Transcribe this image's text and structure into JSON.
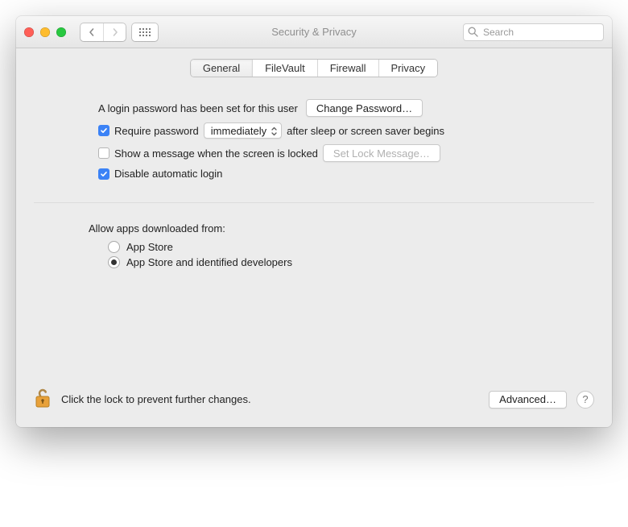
{
  "window": {
    "title": "Security & Privacy"
  },
  "toolbar": {
    "search_placeholder": "Search"
  },
  "tabs": {
    "general": "General",
    "filevault": "FileVault",
    "firewall": "Firewall",
    "privacy": "Privacy",
    "active": "general"
  },
  "login": {
    "intro": "A login password has been set for this user",
    "change_btn": "Change Password…",
    "require_pw_label_pre": "Require password",
    "require_pw_delay": "immediately",
    "require_pw_label_post": "after sleep or screen saver begins",
    "require_pw_checked": true,
    "show_msg_label": "Show a message when the screen is locked",
    "show_msg_checked": false,
    "set_lock_btn": "Set Lock Message…",
    "disable_auto_login_label": "Disable automatic login",
    "disable_auto_login_checked": true
  },
  "gatekeeper": {
    "heading": "Allow apps downloaded from:",
    "option_appstore": "App Store",
    "option_identified": "App Store and identified developers",
    "selected": "identified"
  },
  "footer": {
    "lock_text": "Click the lock to prevent further changes.",
    "advanced_btn": "Advanced…"
  }
}
